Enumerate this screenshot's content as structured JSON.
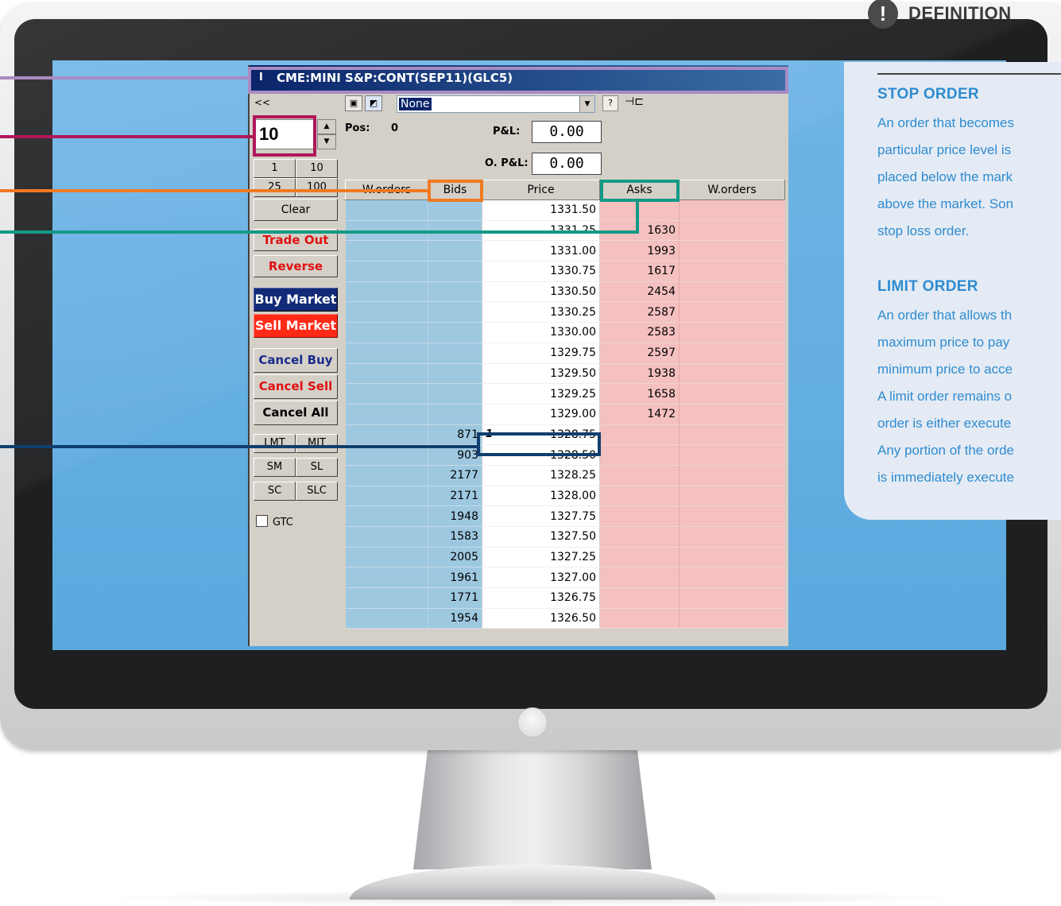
{
  "window": {
    "title": "CME:MINI S&P:CONT(SEP11)(GLC5)",
    "title_icon": "I"
  },
  "order_panel": {
    "collapse_label": "<<",
    "quantity": "10",
    "qty_presets": [
      "1",
      "10",
      "25",
      "100"
    ],
    "clear": "Clear",
    "trade_out": "Trade Out",
    "reverse": "Reverse",
    "buy_market": "Buy Market",
    "sell_market": "Sell Market",
    "cancel_buy": "Cancel Buy",
    "cancel_sell": "Cancel Sell",
    "cancel_all": "Cancel All",
    "order_types": [
      "LMT",
      "MIT",
      "SM",
      "SL",
      "SC",
      "SLC"
    ],
    "gtc_label": "GTC",
    "gtc_checked": false
  },
  "toolbar": {
    "dropdown_value": "None",
    "help_icon": "help-icon",
    "pin_icon": "pin-icon"
  },
  "position": {
    "pos_label": "Pos:",
    "pos_value": "0",
    "pl_label": "P&L:",
    "pl_value": "0.00",
    "opl_label": "O. P&L:",
    "opl_value": "0.00"
  },
  "ladder": {
    "headers": [
      "W.orders",
      "Bids",
      "Price",
      "Asks",
      "W.orders"
    ],
    "rows": [
      {
        "bid": "",
        "price": "1331.50",
        "ask": "",
        "mark": ""
      },
      {
        "bid": "",
        "price": "1331.25",
        "ask": "1630",
        "mark": ""
      },
      {
        "bid": "",
        "price": "1331.00",
        "ask": "1993",
        "mark": ""
      },
      {
        "bid": "",
        "price": "1330.75",
        "ask": "1617",
        "mark": ""
      },
      {
        "bid": "",
        "price": "1330.50",
        "ask": "2454",
        "mark": ""
      },
      {
        "bid": "",
        "price": "1330.25",
        "ask": "2587",
        "mark": ""
      },
      {
        "bid": "",
        "price": "1330.00",
        "ask": "2583",
        "mark": ""
      },
      {
        "bid": "",
        "price": "1329.75",
        "ask": "2597",
        "mark": ""
      },
      {
        "bid": "",
        "price": "1329.50",
        "ask": "1938",
        "mark": ""
      },
      {
        "bid": "",
        "price": "1329.25",
        "ask": "1658",
        "mark": ""
      },
      {
        "bid": "",
        "price": "1329.00",
        "ask": "1472",
        "mark": ""
      },
      {
        "bid": "871",
        "price": "1328.75",
        "ask": "",
        "mark": "1"
      },
      {
        "bid": "903",
        "price": "1328.50",
        "ask": "",
        "mark": ""
      },
      {
        "bid": "2177",
        "price": "1328.25",
        "ask": "",
        "mark": ""
      },
      {
        "bid": "2171",
        "price": "1328.00",
        "ask": "",
        "mark": ""
      },
      {
        "bid": "1948",
        "price": "1327.75",
        "ask": "",
        "mark": ""
      },
      {
        "bid": "1583",
        "price": "1327.50",
        "ask": "",
        "mark": ""
      },
      {
        "bid": "2005",
        "price": "1327.25",
        "ask": "",
        "mark": ""
      },
      {
        "bid": "1961",
        "price": "1327.00",
        "ask": "",
        "mark": ""
      },
      {
        "bid": "1771",
        "price": "1326.75",
        "ask": "",
        "mark": ""
      },
      {
        "bid": "1954",
        "price": "1326.50",
        "ask": "",
        "mark": ""
      }
    ]
  },
  "colors": {
    "callout_title": "#a98bc4",
    "callout_quantity": "#b0175a",
    "callout_bids": "#f07a22",
    "callout_asks": "#139a86",
    "callout_price": "#103e6e",
    "definition_accent": "#2f8cd0"
  },
  "definition": {
    "icon": "!",
    "heading": "DEFINITION",
    "stop_title": "STOP ORDER",
    "stop_text": "An order that becomes\nparticular price level is\nplaced below the mark\nabove the market. Son\nstop loss order.",
    "limit_title": "LIMIT ORDER",
    "limit_text": "An order that allows th\nmaximum price to pay\nminimum price to acce\nA limit order remains o\norder is either execute\nAny portion of the orde\nis immediately execute"
  }
}
